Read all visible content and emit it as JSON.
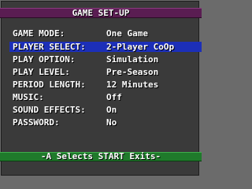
{
  "title": "GAME SET-UP",
  "colors": {
    "title_bar": "#5a1d52",
    "selection": "#1c2fb8",
    "footer_bar": "#1f7a2b",
    "panel": "#3a3a3a",
    "text": "#ffffff"
  },
  "options": [
    {
      "label": "GAME MODE:",
      "value": "One Game"
    },
    {
      "label": "PLAYER SELECT:",
      "value": "2-Player CoOp",
      "selected": true
    },
    {
      "label": "PLAY OPTION:",
      "value": "Simulation"
    },
    {
      "label": "PLAY LEVEL:",
      "value": "Pre-Season"
    },
    {
      "label": "PERIOD LENGTH:",
      "value": "12 Minutes"
    },
    {
      "label": "MUSIC:",
      "value": "Off"
    },
    {
      "label": "SOUND EFFECTS:",
      "value": "On"
    },
    {
      "label": "PASSWORD:",
      "value": "No"
    }
  ],
  "footer": "-A Selects  START Exits-"
}
